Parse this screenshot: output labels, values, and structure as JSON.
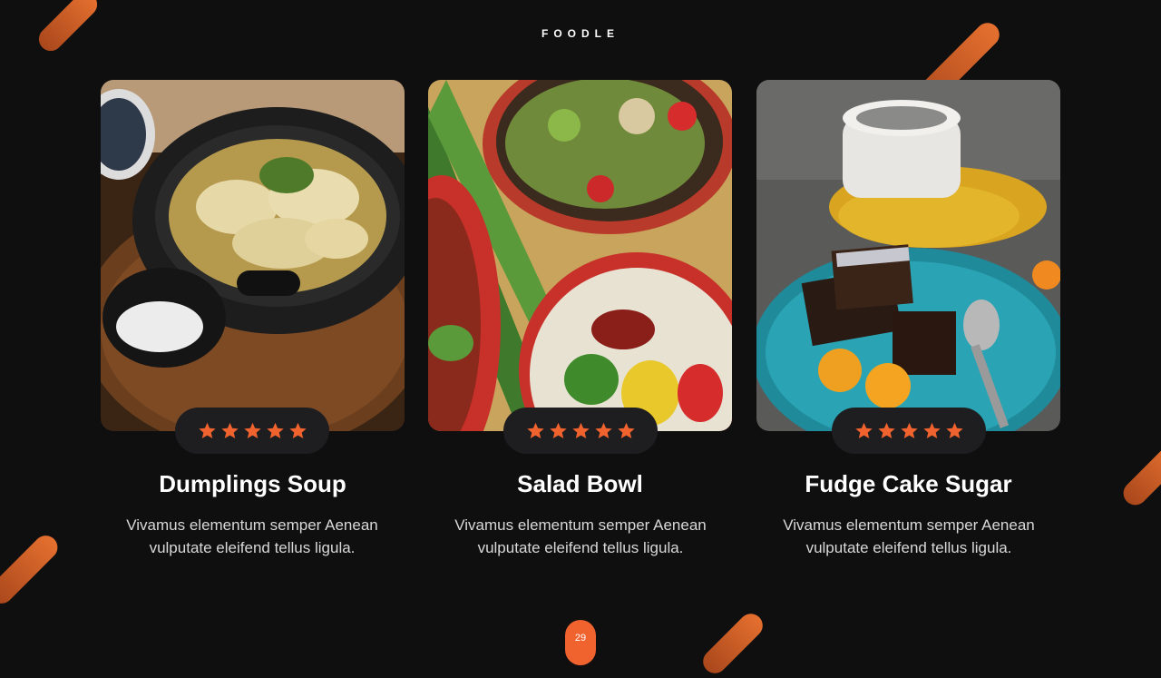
{
  "brand": "FOODLE",
  "accent_color": "#f0622e",
  "cards": [
    {
      "title": "Dumplings Soup",
      "description": "Vivamus elementum semper Aenean vulputate eleifend tellus ligula.",
      "rating": 5,
      "image": "dumplings-soup-photo"
    },
    {
      "title": "Salad Bowl",
      "description": "Vivamus elementum semper Aenean vulputate eleifend tellus ligula.",
      "rating": 5,
      "image": "salad-bowl-photo"
    },
    {
      "title": "Fudge Cake Sugar",
      "description": "Vivamus elementum semper Aenean vulputate eleifend tellus ligula.",
      "rating": 5,
      "image": "fudge-cake-photo"
    }
  ],
  "page_number": "29"
}
